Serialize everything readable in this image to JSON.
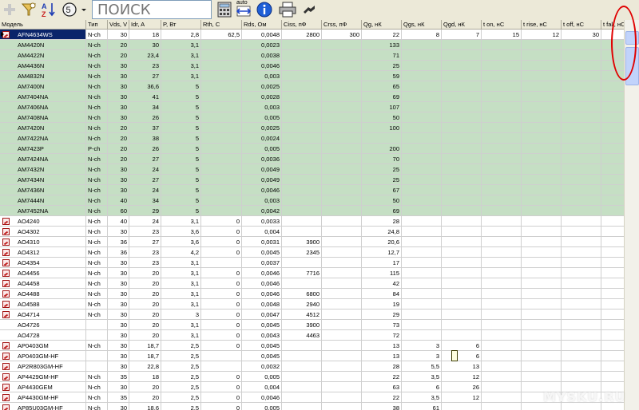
{
  "toolbar": {
    "search_placeholder": "ПОИСК",
    "auto_label": "auto",
    "icons": [
      "add-icon",
      "filter-icon",
      "sort-az-icon",
      "columns-icon",
      "dropdown-icon",
      "calculator-icon",
      "autosize-icon",
      "info-icon",
      "print-icon",
      "exit-icon"
    ]
  },
  "columns": [
    "Модель",
    "Тип",
    "Vds, V",
    "Idr, A",
    "P, Вт",
    "Rth, C",
    "Rds, Ом",
    "Ciss, пФ",
    "Crss, пФ",
    "Qg, нК",
    "Qgs, нК",
    "Qgd, нК",
    "t on, нС",
    "t rise, нС",
    "t off, нС",
    "t fall, нС"
  ],
  "rows": [
    {
      "model": "AFN4634WS",
      "type": "N-ch",
      "vds": "30",
      "idr": "18",
      "p": "2,8",
      "rth": "62,5",
      "rds": "0,0048",
      "ciss": "2800",
      "crss": "300",
      "qg": "22",
      "qgs": "8",
      "qgd": "7",
      "ton": "15",
      "trise": "12",
      "toff": "30",
      "tfall": "",
      "icon": "pdf",
      "hl": "sel"
    },
    {
      "model": "AM4420N",
      "type": "N-ch",
      "vds": "20",
      "idr": "30",
      "p": "3,1",
      "rth": "",
      "rds": "0,0023",
      "ciss": "",
      "crss": "",
      "qg": "133",
      "qgs": "",
      "qgd": "",
      "ton": "",
      "trise": "",
      "toff": "",
      "tfall": "",
      "icon": "",
      "hl": "green"
    },
    {
      "model": "AM4422N",
      "type": "N-ch",
      "vds": "20",
      "idr": "23,4",
      "p": "3,1",
      "rth": "",
      "rds": "0,0038",
      "ciss": "",
      "crss": "",
      "qg": "71",
      "qgs": "",
      "qgd": "",
      "ton": "",
      "trise": "",
      "toff": "",
      "tfall": "",
      "icon": "",
      "hl": "green"
    },
    {
      "model": "AM4436N",
      "type": "N-ch",
      "vds": "30",
      "idr": "23",
      "p": "3,1",
      "rth": "",
      "rds": "0,0046",
      "ciss": "",
      "crss": "",
      "qg": "25",
      "qgs": "",
      "qgd": "",
      "ton": "",
      "trise": "",
      "toff": "",
      "tfall": "",
      "icon": "",
      "hl": "green"
    },
    {
      "model": "AM4832N",
      "type": "N-ch",
      "vds": "30",
      "idr": "27",
      "p": "3,1",
      "rth": "",
      "rds": "0,003",
      "ciss": "",
      "crss": "",
      "qg": "59",
      "qgs": "",
      "qgd": "",
      "ton": "",
      "trise": "",
      "toff": "",
      "tfall": "",
      "icon": "",
      "hl": "green"
    },
    {
      "model": "AM7400N",
      "type": "N-ch",
      "vds": "30",
      "idr": "36,6",
      "p": "5",
      "rth": "",
      "rds": "0,0025",
      "ciss": "",
      "crss": "",
      "qg": "65",
      "qgs": "",
      "qgd": "",
      "ton": "",
      "trise": "",
      "toff": "",
      "tfall": "",
      "icon": "",
      "hl": "green"
    },
    {
      "model": "AM7404NA",
      "type": "N-ch",
      "vds": "30",
      "idr": "41",
      "p": "5",
      "rth": "",
      "rds": "0,0028",
      "ciss": "",
      "crss": "",
      "qg": "69",
      "qgs": "",
      "qgd": "",
      "ton": "",
      "trise": "",
      "toff": "",
      "tfall": "",
      "icon": "",
      "hl": "green"
    },
    {
      "model": "AM7406NA",
      "type": "N-ch",
      "vds": "30",
      "idr": "34",
      "p": "5",
      "rth": "",
      "rds": "0,003",
      "ciss": "",
      "crss": "",
      "qg": "107",
      "qgs": "",
      "qgd": "",
      "ton": "",
      "trise": "",
      "toff": "",
      "tfall": "",
      "icon": "",
      "hl": "green"
    },
    {
      "model": "AM7408NA",
      "type": "N-ch",
      "vds": "30",
      "idr": "26",
      "p": "5",
      "rth": "",
      "rds": "0,005",
      "ciss": "",
      "crss": "",
      "qg": "50",
      "qgs": "",
      "qgd": "",
      "ton": "",
      "trise": "",
      "toff": "",
      "tfall": "",
      "icon": "",
      "hl": "green"
    },
    {
      "model": "AM7420N",
      "type": "N-ch",
      "vds": "20",
      "idr": "37",
      "p": "5",
      "rth": "",
      "rds": "0,0025",
      "ciss": "",
      "crss": "",
      "qg": "100",
      "qgs": "",
      "qgd": "",
      "ton": "",
      "trise": "",
      "toff": "",
      "tfall": "",
      "icon": "",
      "hl": "green"
    },
    {
      "model": "AM7422NA",
      "type": "N-ch",
      "vds": "20",
      "idr": "38",
      "p": "5",
      "rth": "",
      "rds": "0,0024",
      "ciss": "",
      "crss": "",
      "qg": "",
      "qgs": "",
      "qgd": "",
      "ton": "",
      "trise": "",
      "toff": "",
      "tfall": "",
      "icon": "",
      "hl": "green"
    },
    {
      "model": "AM7423P",
      "type": "P-ch",
      "vds": "20",
      "idr": "26",
      "p": "5",
      "rth": "",
      "rds": "0,005",
      "ciss": "",
      "crss": "",
      "qg": "200",
      "qgs": "",
      "qgd": "",
      "ton": "",
      "trise": "",
      "toff": "",
      "tfall": "",
      "icon": "",
      "hl": "green"
    },
    {
      "model": "AM7424NA",
      "type": "N-ch",
      "vds": "20",
      "idr": "27",
      "p": "5",
      "rth": "",
      "rds": "0,0036",
      "ciss": "",
      "crss": "",
      "qg": "70",
      "qgs": "",
      "qgd": "",
      "ton": "",
      "trise": "",
      "toff": "",
      "tfall": "",
      "icon": "",
      "hl": "green"
    },
    {
      "model": "AM7432N",
      "type": "N-ch",
      "vds": "30",
      "idr": "24",
      "p": "5",
      "rth": "",
      "rds": "0,0049",
      "ciss": "",
      "crss": "",
      "qg": "25",
      "qgs": "",
      "qgd": "",
      "ton": "",
      "trise": "",
      "toff": "",
      "tfall": "",
      "icon": "",
      "hl": "green"
    },
    {
      "model": "AM7434N",
      "type": "N-ch",
      "vds": "30",
      "idr": "27",
      "p": "5",
      "rth": "",
      "rds": "0,0049",
      "ciss": "",
      "crss": "",
      "qg": "25",
      "qgs": "",
      "qgd": "",
      "ton": "",
      "trise": "",
      "toff": "",
      "tfall": "",
      "icon": "",
      "hl": "green"
    },
    {
      "model": "AM7436N",
      "type": "N-ch",
      "vds": "30",
      "idr": "24",
      "p": "5",
      "rth": "",
      "rds": "0,0046",
      "ciss": "",
      "crss": "",
      "qg": "67",
      "qgs": "",
      "qgd": "",
      "ton": "",
      "trise": "",
      "toff": "",
      "tfall": "",
      "icon": "",
      "hl": "green"
    },
    {
      "model": "AM7444N",
      "type": "N-ch",
      "vds": "40",
      "idr": "34",
      "p": "5",
      "rth": "",
      "rds": "0,003",
      "ciss": "",
      "crss": "",
      "qg": "50",
      "qgs": "",
      "qgd": "",
      "ton": "",
      "trise": "",
      "toff": "",
      "tfall": "",
      "icon": "",
      "hl": "green"
    },
    {
      "model": "AM7452NA",
      "type": "N-ch",
      "vds": "60",
      "idr": "29",
      "p": "5",
      "rth": "",
      "rds": "0,0042",
      "ciss": "",
      "crss": "",
      "qg": "69",
      "qgs": "",
      "qgd": "",
      "ton": "",
      "trise": "",
      "toff": "",
      "tfall": "",
      "icon": "",
      "hl": "green"
    },
    {
      "model": "AO4240",
      "type": "N-ch",
      "vds": "40",
      "idr": "24",
      "p": "3,1",
      "rth": "0",
      "rds": "0,0033",
      "ciss": "",
      "crss": "",
      "qg": "28",
      "qgs": "",
      "qgd": "",
      "ton": "",
      "trise": "",
      "toff": "",
      "tfall": "",
      "icon": "pdf",
      "hl": ""
    },
    {
      "model": "AO4302",
      "type": "N-ch",
      "vds": "30",
      "idr": "23",
      "p": "3,6",
      "rth": "0",
      "rds": "0,004",
      "ciss": "",
      "crss": "",
      "qg": "24,8",
      "qgs": "",
      "qgd": "",
      "ton": "",
      "trise": "",
      "toff": "",
      "tfall": "",
      "icon": "pdf",
      "hl": ""
    },
    {
      "model": "AO4310",
      "type": "N-ch",
      "vds": "36",
      "idr": "27",
      "p": "3,6",
      "rth": "0",
      "rds": "0,0031",
      "ciss": "3900",
      "crss": "",
      "qg": "20,6",
      "qgs": "",
      "qgd": "",
      "ton": "",
      "trise": "",
      "toff": "",
      "tfall": "",
      "icon": "pdf",
      "hl": ""
    },
    {
      "model": "AO4312",
      "type": "N-ch",
      "vds": "36",
      "idr": "23",
      "p": "4,2",
      "rth": "0",
      "rds": "0,0045",
      "ciss": "2345",
      "crss": "",
      "qg": "12,7",
      "qgs": "",
      "qgd": "",
      "ton": "",
      "trise": "",
      "toff": "",
      "tfall": "",
      "icon": "pdf",
      "hl": ""
    },
    {
      "model": "AO4354",
      "type": "N-ch",
      "vds": "30",
      "idr": "23",
      "p": "3,1",
      "rth": "",
      "rds": "0,0037",
      "ciss": "",
      "crss": "",
      "qg": "17",
      "qgs": "",
      "qgd": "",
      "ton": "",
      "trise": "",
      "toff": "",
      "tfall": "",
      "icon": "pdf",
      "hl": ""
    },
    {
      "model": "AO4456",
      "type": "N-ch",
      "vds": "30",
      "idr": "20",
      "p": "3,1",
      "rth": "0",
      "rds": "0,0046",
      "ciss": "7716",
      "crss": "",
      "qg": "115",
      "qgs": "",
      "qgd": "",
      "ton": "",
      "trise": "",
      "toff": "",
      "tfall": "",
      "icon": "pdf",
      "hl": ""
    },
    {
      "model": "AO4458",
      "type": "N-ch",
      "vds": "30",
      "idr": "20",
      "p": "3,1",
      "rth": "0",
      "rds": "0,0046",
      "ciss": "",
      "crss": "",
      "qg": "42",
      "qgs": "",
      "qgd": "",
      "ton": "",
      "trise": "",
      "toff": "",
      "tfall": "",
      "icon": "pdf",
      "hl": ""
    },
    {
      "model": "AO4488",
      "type": "N-ch",
      "vds": "30",
      "idr": "20",
      "p": "3,1",
      "rth": "0",
      "rds": "0,0046",
      "ciss": "6800",
      "crss": "",
      "qg": "84",
      "qgs": "",
      "qgd": "",
      "ton": "",
      "trise": "",
      "toff": "",
      "tfall": "",
      "icon": "pdf",
      "hl": ""
    },
    {
      "model": "AO4588",
      "type": "N-ch",
      "vds": "30",
      "idr": "20",
      "p": "3,1",
      "rth": "0",
      "rds": "0,0048",
      "ciss": "2940",
      "crss": "",
      "qg": "19",
      "qgs": "",
      "qgd": "",
      "ton": "",
      "trise": "",
      "toff": "",
      "tfall": "",
      "icon": "pdf",
      "hl": ""
    },
    {
      "model": "AO4714",
      "type": "N-ch",
      "vds": "30",
      "idr": "20",
      "p": "3",
      "rth": "0",
      "rds": "0,0047",
      "ciss": "4512",
      "crss": "",
      "qg": "29",
      "qgs": "",
      "qgd": "",
      "ton": "",
      "trise": "",
      "toff": "",
      "tfall": "",
      "icon": "pdf",
      "hl": ""
    },
    {
      "model": "AO4726",
      "type": "",
      "vds": "30",
      "idr": "20",
      "p": "3,1",
      "rth": "0",
      "rds": "0,0045",
      "ciss": "3900",
      "crss": "",
      "qg": "73",
      "qgs": "",
      "qgd": "",
      "ton": "",
      "trise": "",
      "toff": "",
      "tfall": "",
      "icon": "",
      "hl": ""
    },
    {
      "model": "AO4728",
      "type": "",
      "vds": "30",
      "idr": "20",
      "p": "3,1",
      "rth": "0",
      "rds": "0,0043",
      "ciss": "4463",
      "crss": "",
      "qg": "72",
      "qgs": "",
      "qgd": "",
      "ton": "",
      "trise": "",
      "toff": "",
      "tfall": "",
      "icon": "",
      "hl": ""
    },
    {
      "model": "AP0403GM",
      "type": "N-ch",
      "vds": "30",
      "idr": "18,7",
      "p": "2,5",
      "rth": "0",
      "rds": "0,0045",
      "ciss": "",
      "crss": "",
      "qg": "13",
      "qgs": "3",
      "qgd": "6",
      "ton": "",
      "trise": "",
      "toff": "",
      "tfall": "",
      "icon": "pdf",
      "hl": ""
    },
    {
      "model": "AP0403GM-HF",
      "type": "",
      "vds": "30",
      "idr": "18,7",
      "p": "2,5",
      "rth": "",
      "rds": "0,0045",
      "ciss": "",
      "crss": "",
      "qg": "13",
      "qgs": "3",
      "qgd": "6",
      "ton": "",
      "trise": "",
      "toff": "",
      "tfall": "",
      "icon": "pdf",
      "hl": ""
    },
    {
      "model": "AP2R803GM-HF",
      "type": "",
      "vds": "30",
      "idr": "22,8",
      "p": "2,5",
      "rth": "",
      "rds": "0,0032",
      "ciss": "",
      "crss": "",
      "qg": "28",
      "qgs": "5,5",
      "qgd": "13",
      "ton": "",
      "trise": "",
      "toff": "",
      "tfall": "",
      "icon": "pdf",
      "hl": ""
    },
    {
      "model": "AP4429GM-HF",
      "type": "N-ch",
      "vds": "35",
      "idr": "18",
      "p": "2,5",
      "rth": "0",
      "rds": "0,005",
      "ciss": "",
      "crss": "",
      "qg": "22",
      "qgs": "3,5",
      "qgd": "12",
      "ton": "",
      "trise": "",
      "toff": "",
      "tfall": "",
      "icon": "pdf",
      "hl": ""
    },
    {
      "model": "AP4430GEM",
      "type": "N-ch",
      "vds": "30",
      "idr": "20",
      "p": "2,5",
      "rth": "0",
      "rds": "0,004",
      "ciss": "",
      "crss": "",
      "qg": "63",
      "qgs": "6",
      "qgd": "26",
      "ton": "",
      "trise": "",
      "toff": "",
      "tfall": "",
      "icon": "pdf",
      "hl": ""
    },
    {
      "model": "AP4430GM-HF",
      "type": "N-ch",
      "vds": "35",
      "idr": "20",
      "p": "2,5",
      "rth": "0",
      "rds": "0,0046",
      "ciss": "",
      "crss": "",
      "qg": "22",
      "qgs": "3,5",
      "qgd": "12",
      "ton": "",
      "trise": "",
      "toff": "",
      "tfall": "",
      "icon": "pdf",
      "hl": ""
    },
    {
      "model": "AP85U03GM-HF",
      "type": "N-ch",
      "vds": "30",
      "idr": "18,6",
      "p": "2,5",
      "rth": "0",
      "rds": "0,005",
      "ciss": "",
      "crss": "",
      "qg": "38",
      "qgs": "61",
      "qgd": "",
      "ton": "",
      "trise": "",
      "toff": "",
      "tfall": "",
      "icon": "pdf",
      "hl": ""
    }
  ],
  "watermark": "MYSKU.RU",
  "colors": {
    "green": "#c5dfc4",
    "selected": "#0a246a",
    "header": "#ece9d8",
    "annotation": "#e00000"
  }
}
